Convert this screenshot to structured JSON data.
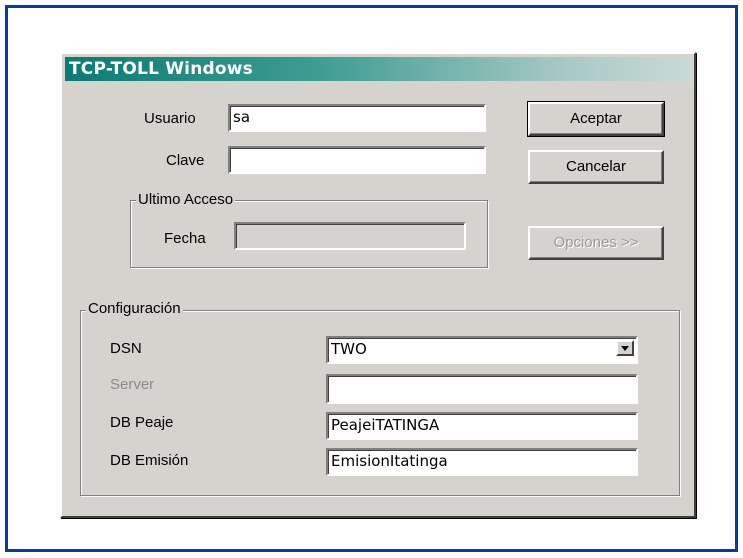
{
  "dialog": {
    "title": "TCP-TOLL Windows"
  },
  "login": {
    "usuario_label": "Usuario",
    "usuario_value": "sa",
    "clave_label": "Clave",
    "clave_value": ""
  },
  "ultimo_acceso": {
    "legend": "Ultimo Acceso",
    "fecha_label": "Fecha",
    "fecha_value": ""
  },
  "buttons": {
    "aceptar": "Aceptar",
    "cancelar": "Cancelar",
    "opciones": "Opciones >>"
  },
  "configuracion": {
    "legend": "Configuración",
    "dsn_label": "DSN",
    "dsn_value": "TWO",
    "server_label": "Server",
    "server_value": "",
    "db_peaje_label": "DB Peaje",
    "db_peaje_value": "PeajeiTATINGA",
    "db_emision_label": "DB Emisión",
    "db_emision_value": "EmisionItatinga"
  },
  "colors": {
    "frame_border": "#0b3a9a",
    "title_start": "#0c7a74",
    "dialog_face": "#d6d3ce"
  },
  "icons": {
    "dropdown": "chevron-down-icon"
  }
}
